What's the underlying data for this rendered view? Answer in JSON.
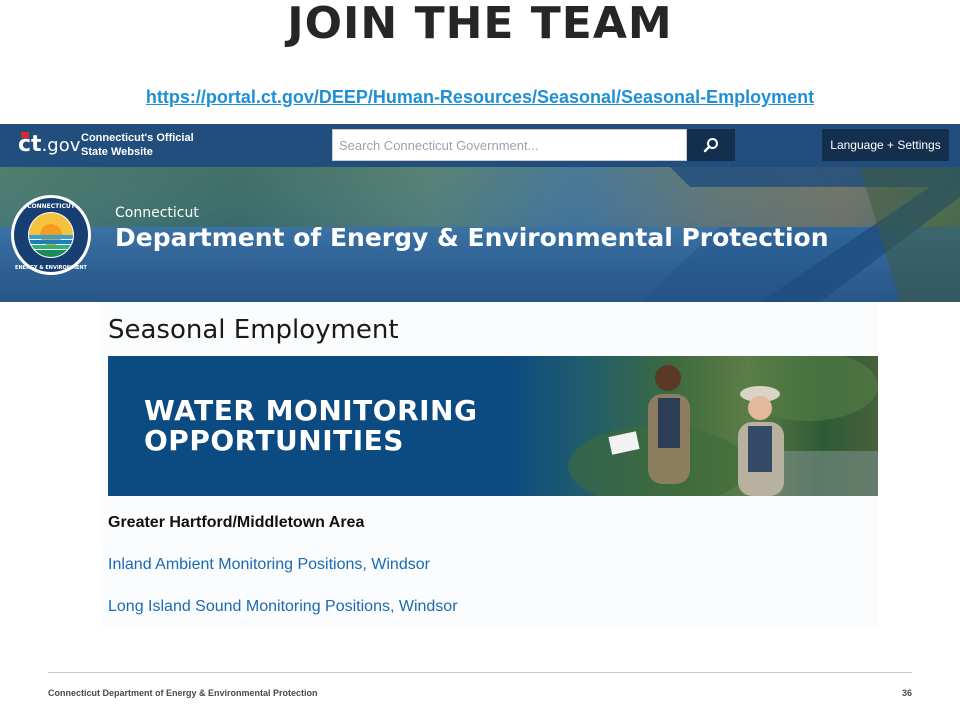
{
  "slide": {
    "title": "JOIN THE TEAM",
    "url": "https://portal.ct.gov/DEEP/Human-Resources/Seasonal/Seasonal-Employment"
  },
  "ctgov_header": {
    "logo_ct": "ct",
    "logo_gov": ".gov",
    "official_line1": "Connecticut's Official",
    "official_line2": "State Website",
    "search_placeholder": "Search Connecticut Government...",
    "search_icon": "search-icon",
    "language_button": "Language + Settings"
  },
  "agency_banner": {
    "state": "Connecticut",
    "agency": "Department of Energy & Environmental Protection",
    "seal_text_top": "CONNECTICUT",
    "seal_text_bottom": "ENERGY & ENVIRONMENT"
  },
  "page": {
    "heading": "Seasonal Employment",
    "promo_line1": "WATER MONITORING",
    "promo_line2": "OPPORTUNITIES",
    "area_label": "Greater Hartford/Middletown Area",
    "links": [
      "Inland Ambient Monitoring Positions, Windsor",
      "Long Island Sound Monitoring Positions, Windsor"
    ]
  },
  "footer": {
    "org": "Connecticut Department of Energy & Environmental Protection",
    "page_number": "36"
  },
  "colors": {
    "ctgov_bar": "#214e7d",
    "dark_button": "#132f4d",
    "promo_blue": "#0c4a82",
    "link_blue": "#1b6ab3",
    "url_blue": "#1f8fd6"
  }
}
